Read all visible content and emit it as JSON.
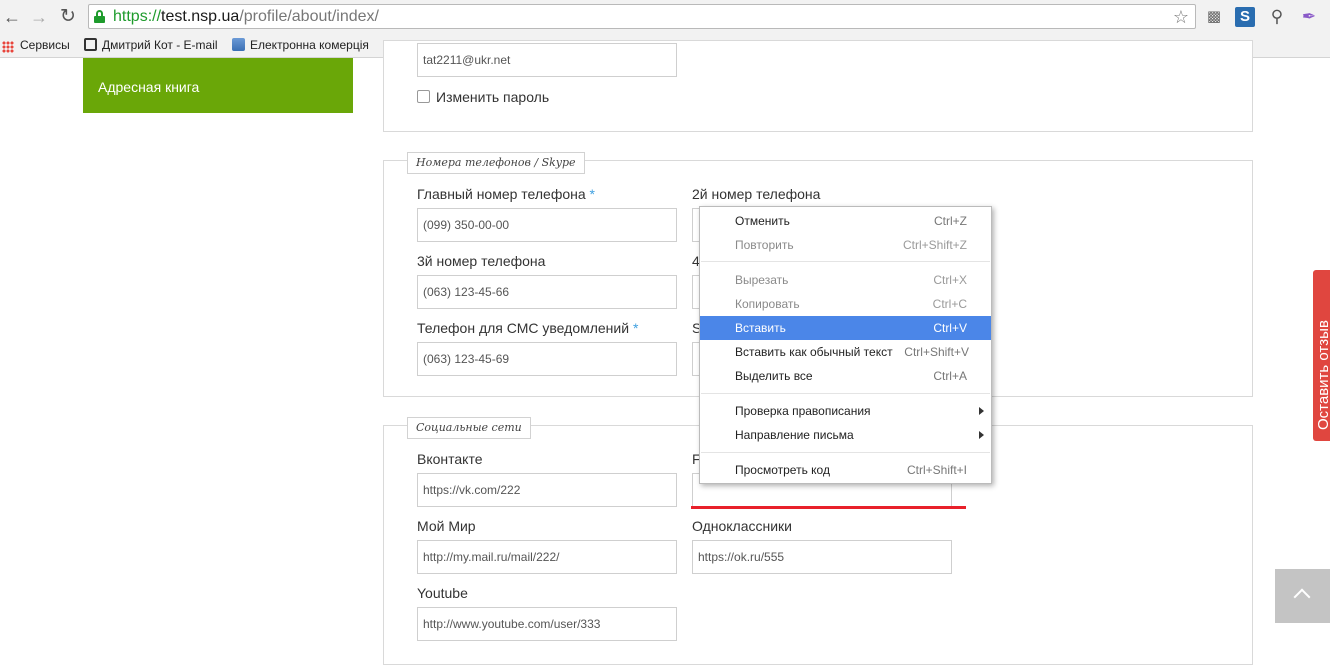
{
  "browser": {
    "url_scheme": "https://",
    "url_host": "test.nsp.ua",
    "url_path": "/profile/about/index/",
    "bookmarks": [
      {
        "label": "Сервисы"
      },
      {
        "label": "Дмитрий Кот - E-mail"
      },
      {
        "label": "Електронна комерція"
      }
    ]
  },
  "sidebar": {
    "active_item": "Адресная книга"
  },
  "account": {
    "email_value": "tat2211@ukr.net",
    "change_password_label": "Изменить пароль"
  },
  "phones": {
    "legend": "Номера телефонов / Skype",
    "main_label": "Главный номер телефона",
    "main_value": "(099) 350-00-00",
    "second_label": "2й номер телефона",
    "third_label": "3й номер телефона",
    "third_value": "(063) 123-45-66",
    "fourth_label_partial": "4",
    "sms_label": "Телефон для СМС уведомлений",
    "sms_value": "(063) 123-45-69",
    "skype_label_partial": "S",
    "required_mark": "*"
  },
  "social": {
    "legend": "Социальные сети",
    "vk_label": "Вконтакте",
    "vk_value": "https://vk.com/222",
    "fb_label_partial": "F",
    "mymir_label": "Мой Мир",
    "mymir_value": "http://my.mail.ru/mail/222/",
    "ok_label": "Одноклассники",
    "ok_value": "https://ok.ru/555",
    "youtube_label": "Youtube",
    "youtube_value": "http://www.youtube.com/user/333"
  },
  "context_menu": {
    "items": [
      {
        "label": "Отменить",
        "shortcut": "Ctrl+Z",
        "state": "normal"
      },
      {
        "label": "Повторить",
        "shortcut": "Ctrl+Shift+Z",
        "state": "disabled"
      },
      {
        "label": "Вырезать",
        "shortcut": "Ctrl+X",
        "state": "disabled"
      },
      {
        "label": "Копировать",
        "shortcut": "Ctrl+C",
        "state": "disabled"
      },
      {
        "label": "Вставить",
        "shortcut": "Ctrl+V",
        "state": "active"
      },
      {
        "label": "Вставить как обычный текст",
        "shortcut": "Ctrl+Shift+V",
        "state": "normal"
      },
      {
        "label": "Выделить все",
        "shortcut": "Ctrl+A",
        "state": "normal"
      },
      {
        "label": "Проверка правописания",
        "shortcut": "",
        "state": "submenu"
      },
      {
        "label": "Направление письма",
        "shortcut": "",
        "state": "submenu"
      },
      {
        "label": "Просмотреть код",
        "shortcut": "Ctrl+Shift+I",
        "state": "normal"
      }
    ]
  },
  "feedback_tab": {
    "label": "Оставить отзыв"
  },
  "icons": {
    "back": "back-arrow-icon",
    "forward": "forward-arrow-icon",
    "reload": "reload-icon",
    "lock": "lock-icon",
    "star": "bookmark-star-icon",
    "scroll_top": "chevron-up-icon"
  },
  "colors": {
    "sidebar_green": "#6aa708",
    "menu_highlight": "#4b86e8",
    "feedback_red": "#e0463f",
    "secure_green": "#1e9b2c"
  }
}
